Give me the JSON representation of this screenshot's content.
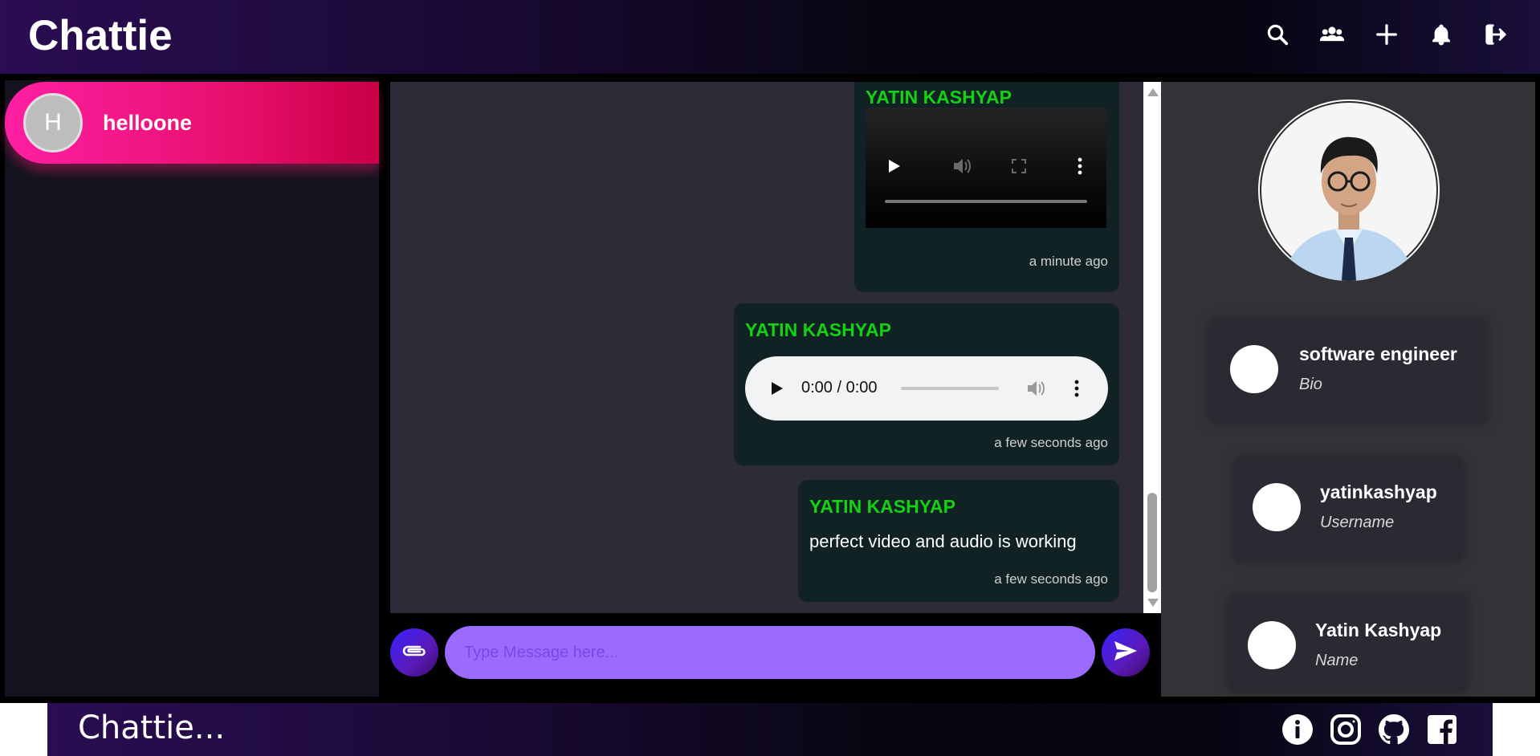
{
  "header": {
    "title": "Chattie",
    "icons": [
      "search-icon",
      "group-icon",
      "plus-icon",
      "bell-icon",
      "logout-icon"
    ]
  },
  "sidebar": {
    "chats": [
      {
        "initial": "H",
        "name": "helloone"
      }
    ]
  },
  "messages": [
    {
      "author": "YATIN KASHYAP",
      "type": "video",
      "time": "a minute ago"
    },
    {
      "author": "YATIN KASHYAP",
      "type": "audio",
      "audio_time": "0:00 / 0:00",
      "time": "a few seconds ago"
    },
    {
      "author": "YATIN KASHYAP",
      "type": "text",
      "text": "perfect video and audio is working",
      "time": "a few seconds ago"
    }
  ],
  "composer": {
    "placeholder": "Type Message here..."
  },
  "profile": {
    "fields": [
      {
        "value": "software engineer",
        "label": "Bio"
      },
      {
        "value": "yatinkashyap",
        "label": "Username"
      },
      {
        "value": "Yatin Kashyap",
        "label": "Name"
      }
    ]
  },
  "footer": {
    "brand": "Chattie...",
    "icons": [
      "info-icon",
      "instagram-icon",
      "github-icon",
      "facebook-icon"
    ]
  },
  "colors": {
    "accent_pink": "#ff1fa4",
    "author_green": "#13d213",
    "input_purple": "#9b6bff",
    "message_bg": "#102224"
  }
}
